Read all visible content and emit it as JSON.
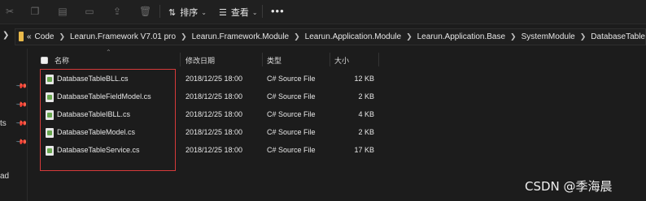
{
  "toolbar": {
    "sort_label": "排序",
    "view_label": "查看",
    "more_label": "•••",
    "icons": [
      "cut-icon",
      "copy-icon",
      "paste-icon",
      "rename-icon",
      "share-icon",
      "delete-icon"
    ]
  },
  "address": {
    "prefix": "«",
    "crumbs": [
      "Code",
      "Learun.Framework V7.01 pro",
      "Learun.Framework.Module",
      "Learun.Application.Module",
      "Learun.Application.Base",
      "SystemModule",
      "DatabaseTable"
    ]
  },
  "sidebar": {
    "labels": [
      "ts",
      "ad"
    ]
  },
  "columns": {
    "name": "名称",
    "modified": "修改日期",
    "type": "类型",
    "size": "大小"
  },
  "files": [
    {
      "name": "DatabaseTableBLL.cs",
      "modified": "2018/12/25 18:00",
      "type": "C# Source File",
      "size": "12 KB"
    },
    {
      "name": "DatabaseTableFieldModel.cs",
      "modified": "2018/12/25 18:00",
      "type": "C# Source File",
      "size": "2 KB"
    },
    {
      "name": "DatabaseTableIBLL.cs",
      "modified": "2018/12/25 18:00",
      "type": "C# Source File",
      "size": "4 KB"
    },
    {
      "name": "DatabaseTableModel.cs",
      "modified": "2018/12/25 18:00",
      "type": "C# Source File",
      "size": "2 KB"
    },
    {
      "name": "DatabaseTableService.cs",
      "modified": "2018/12/25 18:00",
      "type": "C# Source File",
      "size": "17 KB"
    }
  ],
  "watermark": "CSDN @季海晨",
  "colors": {
    "background": "#1c1c1c",
    "highlight": "#d63a3a",
    "folder": "#e9b94a"
  }
}
